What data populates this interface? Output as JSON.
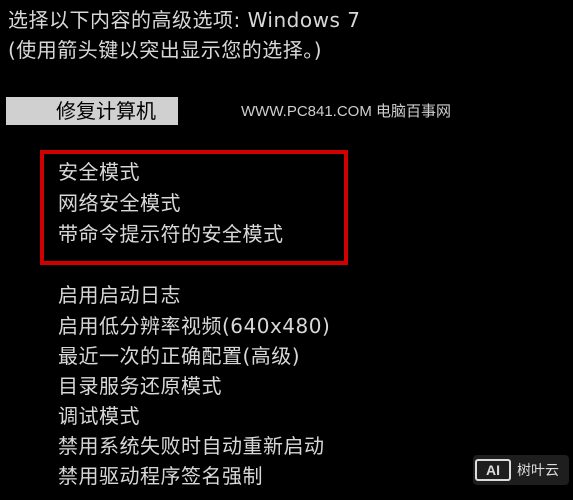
{
  "header": {
    "title": "选择以下内容的高级选项: Windows 7",
    "subtitle": "(使用箭头键以突出显示您的选择。)"
  },
  "selected_option": "修复计算机",
  "watermark": "WWW.PC841.COM 电脑百事网",
  "highlighted_options": [
    "安全模式",
    "网络安全模式",
    "带命令提示符的安全模式"
  ],
  "other_options": [
    "启用启动日志",
    "启用低分辨率视频(640x480)",
    "最近一次的正确配置(高级)",
    "目录服务还原模式",
    "调试模式",
    "禁用系统失败时自动重新启动",
    "禁用驱动程序签名强制"
  ],
  "badge": {
    "logo": "AI",
    "brand": "树叶云"
  },
  "colors": {
    "background": "#000000",
    "text": "#d8d8d8",
    "selection_bg": "#d0d0d0",
    "highlight_border": "#d00000"
  }
}
